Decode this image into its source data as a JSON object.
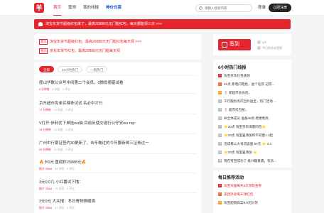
{
  "header": {
    "logo_text": "羊",
    "nav": [
      {
        "label": "首页",
        "state": "active"
      },
      {
        "label": "蓝领",
        "state": "normal"
      },
      {
        "label": "我的线报",
        "state": "normal"
      },
      {
        "label": "神价白菜",
        "state": "highlight"
      }
    ],
    "search_placeholder": "请输入搜索内容",
    "login_label": "登录",
    "register_label": "立即注册"
  },
  "banner": {
    "text": "淘宝年货节超级红包来了，最高20888元无门槛红包，每天都能领三次 >>>"
  },
  "promo": [
    {
      "tag": "置顶",
      "text": "淘宝年货节超级红包，最高20888元无门槛红包每天领 >>>"
    },
    {
      "tag": "置顶",
      "text": "京东年货节红包，最高20888元无门槛每天领"
    }
  ],
  "feed": {
    "tabs": [
      "全部",
      "24小时热门",
      "一周热门"
    ],
    "active_tab": 0,
    "items": [
      {
        "title": "度山华数公众号中间第二个会员，0撸肯德基试看",
        "time": "6 分钟前",
        "views": "5 浏览",
        "comments": "0 评论"
      },
      {
        "title": "京东超市免单买辣条试试 名必中才行",
        "time": "17 分钟前",
        "views": "15 浏览",
        "comments": "0 评论"
      },
      {
        "title": "V打开 伊利优下单挂wu抽 目前反使交逍行公仔安wu mp:",
        "time": "19 分钟前",
        "views": "13 浏览",
        "comments": "0 评论"
      },
      {
        "title": "广州中行银证签约30更新了，去年做过的今年要新绑三证券过一",
        "time": "20 分钟前",
        "views": "21 浏览",
        "comments": "0 评论"
      },
      {
        "title": "🔥卡0元 重磅秒25888元🔥",
        "time": "刚才 25/64",
        "views": "98 浏览",
        "comments": "0 评论"
      },
      {
        "title": "3元0.0几 小红薯试下撸：",
        "time": "刚才 25/64",
        "views": "79 浏览",
        "comments": "0 评论"
      },
      {
        "title": "3元0元 大众搜：冬日寄物情暖周",
        "time": "刚才 25/64",
        "views": "47 浏览",
        "comments": "0 评论"
      }
    ]
  },
  "signin": {
    "label": "签到",
    "people": "1人",
    "status": "今日你还未签到"
  },
  "hot": {
    "title": "6小时热门线报",
    "items": [
      "淘宝京东红包速领",
      "21点 家电闪电抢，送个证券 记得...",
      "❗ 新超市会员抢，",
      "工行服务务内当外送全，热门活动 ...",
      "❗ 超市红包抢，",
      "命全体成员 准备30点 爬楼者高",
      "⭐20点 淘宝京东海量同包⭐",
      "⭐20点 淘宝猫添加和不同量1.1起",
      "活成看公大号玩竖画 50元 ⭐ 4.4",
      "⭐20点 淘宝猫添加 ⭐",
      "现在有回成功了 抵兴趣看遇，农乐..."
    ]
  },
  "daily": {
    "title": "每日推荐活动",
    "items": [
      {
        "text": "淘宝天猫每天3次领现金券",
        "highlight": true
      },
      {
        "text": "美团外卖每天领红包",
        "highlight": true
      },
      {
        "text": "淘宝超值白菜9.9元封顶",
        "highlight": false
      }
    ]
  },
  "colors": {
    "accent": "#e3262e",
    "highlight_nav": "#1a55d6",
    "register_button": "#222222"
  }
}
